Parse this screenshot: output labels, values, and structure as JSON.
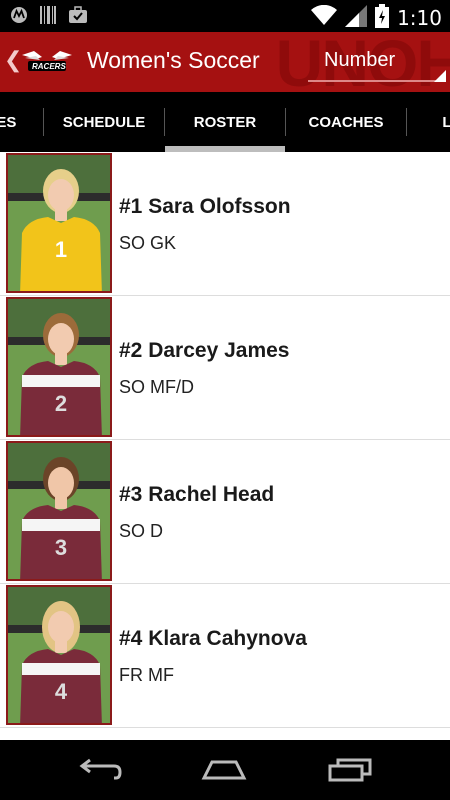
{
  "status": {
    "time": "1:10",
    "icons": [
      "motorola-icon",
      "barcode-icon",
      "briefcase-icon",
      "wifi-icon",
      "signal-icon",
      "battery-charging-icon"
    ]
  },
  "header": {
    "title": "Women's Soccer",
    "logo_text": "RACERS",
    "watermark": "UNOH",
    "sort_selected": "Number"
  },
  "tabs": [
    {
      "label": "NES",
      "selected": false
    },
    {
      "label": "SCHEDULE",
      "selected": false
    },
    {
      "label": "ROSTER",
      "selected": true
    },
    {
      "label": "COACHES",
      "selected": false
    },
    {
      "label": "L",
      "selected": false
    }
  ],
  "roster": [
    {
      "name": "#1 Sara Olofsson",
      "info": "SO GK",
      "jersey": "1",
      "jersey_color": "#f2c41a",
      "hair_color": "#e6cf8a"
    },
    {
      "name": "#2 Darcey James",
      "info": "SO MF/D",
      "jersey": "2",
      "jersey_color": "#7a2b3a",
      "hair_color": "#9c6b3a"
    },
    {
      "name": "#3 Rachel Head",
      "info": "SO D",
      "jersey": "3",
      "jersey_color": "#7a2b3a",
      "hair_color": "#6b4428"
    },
    {
      "name": "#4 Klara Cahynova",
      "info": "FR MF",
      "jersey": "4",
      "jersey_color": "#7a2b3a",
      "hair_color": "#e2c484"
    }
  ],
  "colors": {
    "action_bar": "#a51111",
    "photo_border": "#8b1a1a",
    "tab_indicator": "#bdbdbd"
  }
}
